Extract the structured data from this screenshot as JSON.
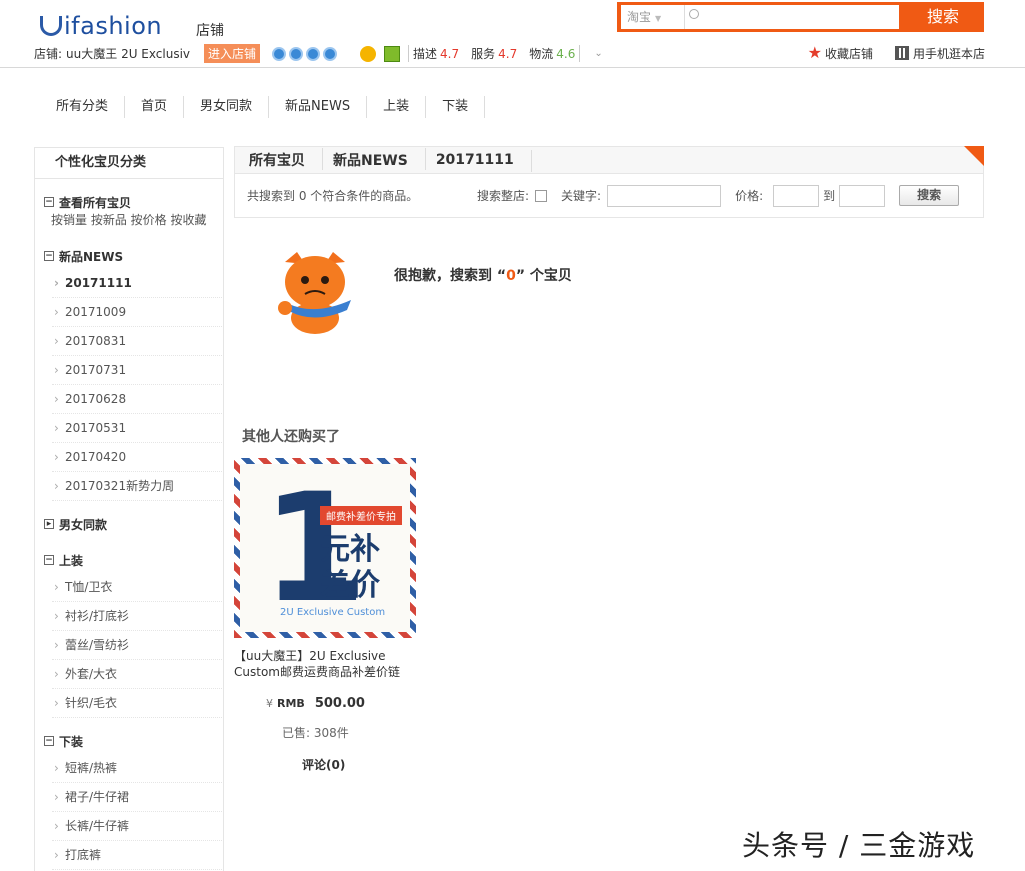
{
  "header": {
    "logo": "ifashion",
    "shop_link": "店铺",
    "search": {
      "scope": "淘宝",
      "placeholder": "",
      "button": "搜索"
    },
    "shop": {
      "label": "店铺:",
      "name": "uu大魔王 2U Exclusiv",
      "enter": "进入店铺",
      "ratings": [
        {
          "label": "描述",
          "value": "4.7"
        },
        {
          "label": "服务",
          "value": "4.7"
        },
        {
          "label": "物流",
          "value": "4.6"
        }
      ]
    },
    "actions": {
      "favorite": "收藏店铺",
      "mobile": "用手机逛本店"
    }
  },
  "nav": [
    "所有分类",
    "首页",
    "男女同款",
    "新品NEWS",
    "上装",
    "下装"
  ],
  "sidebar": {
    "title": "个性化宝贝分类",
    "all": "查看所有宝贝",
    "sorts": "按销量 按新品 按价格 按收藏",
    "groups": [
      {
        "title": "新品NEWS",
        "items": [
          "20171111",
          "20171009",
          "20170831",
          "20170731",
          "20170628",
          "20170531",
          "20170420",
          "20170321新势力周"
        ]
      },
      {
        "title": "男女同款",
        "items": []
      },
      {
        "title": "上装",
        "items": [
          "T恤/卫衣",
          "衬衫/打底衫",
          "蕾丝/雪纺衫",
          "外套/大衣",
          "针织/毛衣"
        ]
      },
      {
        "title": "下装",
        "items": [
          "短裤/热裤",
          "裙子/牛仔裙",
          "长裤/牛仔裤",
          "打底裤"
        ]
      }
    ]
  },
  "breadcrumb": [
    "所有宝贝",
    "新品NEWS",
    "20171111"
  ],
  "filter": {
    "count_text": "共搜索到 0 个符合条件的商品。",
    "search_shop": "搜索整店:",
    "keyword": "关键字:",
    "price": "价格:",
    "to": "到",
    "button": "搜索"
  },
  "empty": {
    "pre": "很抱歉，搜索到 “",
    "num": "0",
    "post": "” 个宝贝"
  },
  "also": {
    "title": "其他人还购买了",
    "product": {
      "img_badge": "邮费补差价专拍",
      "img_line1": "元补",
      "img_line2": "差价",
      "img_big": "1",
      "img_en": "2U Exclusive Custom",
      "title": "【uu大魔王】2U Exclusive Custom邮费运费商品补差价链",
      "yen": "¥",
      "currency": "RMB",
      "price": "500.00",
      "sold": "已售: 308件",
      "reviews": "评论(0)"
    }
  },
  "watermark": "头条号 / 三金游戏"
}
